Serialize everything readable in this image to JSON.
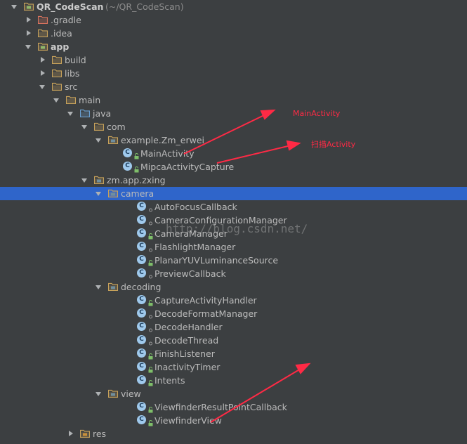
{
  "project": {
    "name": "QR_CodeScan",
    "path": "(~/QR_CodeScan)"
  },
  "tree": [
    {
      "label": "QR_CodeScan",
      "hint": "(~/QR_CodeScan)",
      "type": "module",
      "depth": 0,
      "expanded": true,
      "bold": true
    },
    {
      "label": ".gradle",
      "type": "folder-red",
      "depth": 1,
      "expanded": false
    },
    {
      "label": ".idea",
      "type": "folder",
      "depth": 1,
      "expanded": false
    },
    {
      "label": "app",
      "type": "module",
      "depth": 1,
      "expanded": true,
      "bold": true
    },
    {
      "label": "build",
      "type": "folder",
      "depth": 2,
      "expanded": false
    },
    {
      "label": "libs",
      "type": "folder",
      "depth": 2,
      "expanded": false
    },
    {
      "label": "src",
      "type": "folder",
      "depth": 2,
      "expanded": true
    },
    {
      "label": "main",
      "type": "folder",
      "depth": 3,
      "expanded": true
    },
    {
      "label": "java",
      "type": "folder-blue",
      "depth": 4,
      "expanded": true
    },
    {
      "label": "com",
      "type": "folder",
      "depth": 5,
      "expanded": true
    },
    {
      "label": "example.Zm_erwei",
      "type": "package",
      "depth": 6,
      "expanded": true
    },
    {
      "label": "MainActivity",
      "type": "class",
      "depth": 7
    },
    {
      "label": "MipcaActivityCapture",
      "type": "class",
      "depth": 7
    },
    {
      "label": "zm.app.zxing",
      "type": "package",
      "depth": 5,
      "expanded": true
    },
    {
      "label": "camera",
      "type": "package",
      "depth": 6,
      "expanded": true,
      "selected": true
    },
    {
      "label": "AutoFocusCallback",
      "type": "class-dot",
      "depth": 8
    },
    {
      "label": "CameraConfigurationManager",
      "type": "class-dot",
      "depth": 8
    },
    {
      "label": "CameraManager",
      "type": "class",
      "depth": 8
    },
    {
      "label": "FlashlightManager",
      "type": "class-dot",
      "depth": 8
    },
    {
      "label": "PlanarYUVLuminanceSource",
      "type": "class",
      "depth": 8
    },
    {
      "label": "PreviewCallback",
      "type": "class-dot",
      "depth": 8
    },
    {
      "label": "decoding",
      "type": "package",
      "depth": 6,
      "expanded": true
    },
    {
      "label": "CaptureActivityHandler",
      "type": "class",
      "depth": 8
    },
    {
      "label": "DecodeFormatManager",
      "type": "class-dot",
      "depth": 8
    },
    {
      "label": "DecodeHandler",
      "type": "class-dot",
      "depth": 8
    },
    {
      "label": "DecodeThread",
      "type": "class-dot",
      "depth": 8
    },
    {
      "label": "FinishListener",
      "type": "class",
      "depth": 8
    },
    {
      "label": "InactivityTimer",
      "type": "class",
      "depth": 8
    },
    {
      "label": "Intents",
      "type": "class",
      "depth": 8
    },
    {
      "label": "view",
      "type": "package",
      "depth": 6,
      "expanded": true
    },
    {
      "label": "ViewfinderResultPointCallback",
      "type": "class",
      "depth": 8
    },
    {
      "label": "ViewfinderView",
      "type": "class",
      "depth": 8
    },
    {
      "label": "res",
      "type": "folder-res",
      "depth": 4,
      "expanded": false
    }
  ],
  "annotations": {
    "main_activity": "MainActivity",
    "scan_activity": "扫描Activity"
  },
  "watermark": "http://blog.csdn.net/",
  "colors": {
    "background": "#3c3f41",
    "selection": "#2f65ca",
    "text": "#bbbbbb",
    "folder": "#c6a15a",
    "annotation": "#ff2a45"
  }
}
